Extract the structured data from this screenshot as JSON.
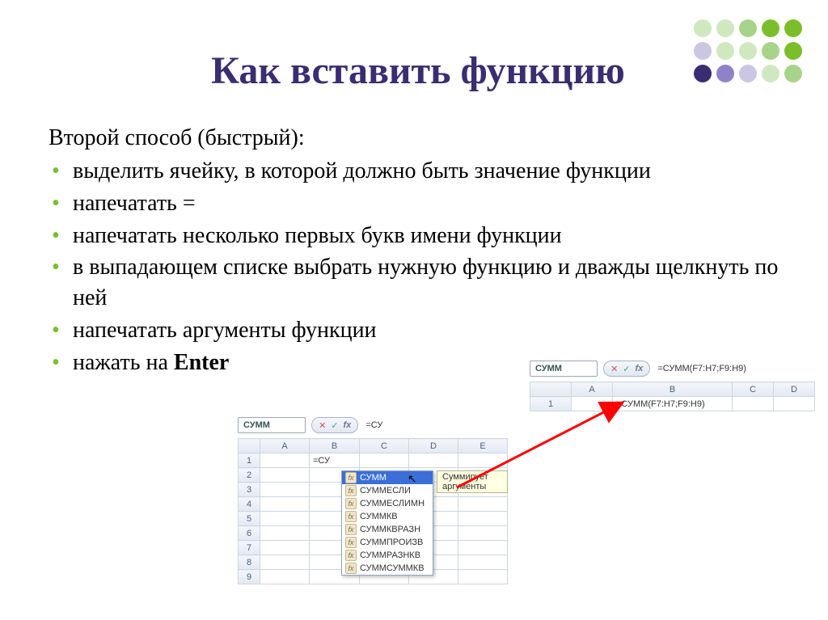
{
  "title": "Как вставить функцию",
  "subtitle": "Второй способ (быстрый):",
  "bullets": [
    "выделить ячейку, в которой должно быть значение функции",
    "напечатать =",
    "напечатать несколько первых букв имени функции",
    "в выпадающем списке выбрать нужную функцию и дважды щелкнуть по ней",
    "напечатать аргументы функции",
    "нажать на "
  ],
  "bullet_enter": "Enter",
  "excel1": {
    "namebox": "СУММ",
    "formula_short": "=СУ",
    "cell_input": "=СУ",
    "cols": [
      "A",
      "B",
      "C",
      "D",
      "E"
    ],
    "rows": [
      "1",
      "2",
      "3",
      "4",
      "5",
      "6",
      "7",
      "8",
      "9"
    ],
    "autocomplete": [
      "СУММ",
      "СУММЕСЛИ",
      "СУММЕСЛИМН",
      "СУММКВ",
      "СУММКВРАЗН",
      "СУММПРОИЗВ",
      "СУММРАЗНКВ",
      "СУММСУММКВ"
    ],
    "tooltip": "Суммирует аргументы"
  },
  "excel2": {
    "namebox": "СУММ",
    "formula_full": "=СУММ(F7:H7;F9:H9)",
    "cell_value": "=СУММ(F7:H7;F9:H9)",
    "cols": [
      "A",
      "B",
      "C",
      "D"
    ],
    "row": "1"
  }
}
